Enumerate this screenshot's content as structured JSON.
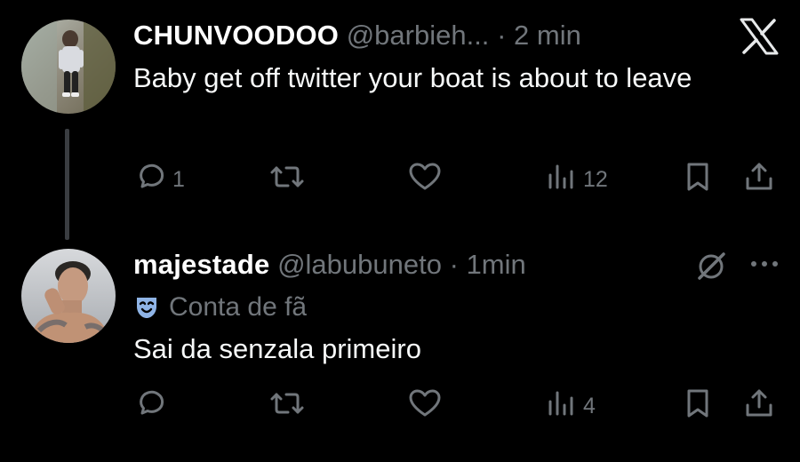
{
  "tweets": [
    {
      "name": "CHUNVOODOO",
      "handle": "@barbieh...",
      "separator": "·",
      "time": "2 min",
      "text": "Baby get off twitter your boat is about to leave",
      "reply_count": "1",
      "repost_count": "",
      "like_count": "",
      "views_count": "12"
    },
    {
      "name": "majestade",
      "handle": "@labubuneto",
      "separator": "·",
      "time": "1min",
      "badge_label": "Conta de fã",
      "text": "Sai da senzala primeiro",
      "reply_count": "",
      "repost_count": "",
      "like_count": "",
      "views_count": "4"
    }
  ],
  "icons": {
    "brand": "x-logo-icon",
    "tweet2_menu": [
      "grok-icon",
      "more-icon"
    ],
    "badge": "theater-mask-icon",
    "actions": [
      "reply-icon",
      "repost-icon",
      "like-icon",
      "views-icon",
      "bookmark-icon",
      "share-icon"
    ]
  },
  "colors": {
    "background": "#000000",
    "primary_text": "#e7e9ea",
    "secondary_text": "#71767b",
    "thread_line": "#3a3d41",
    "badge_icon": "#8fb4e6"
  }
}
